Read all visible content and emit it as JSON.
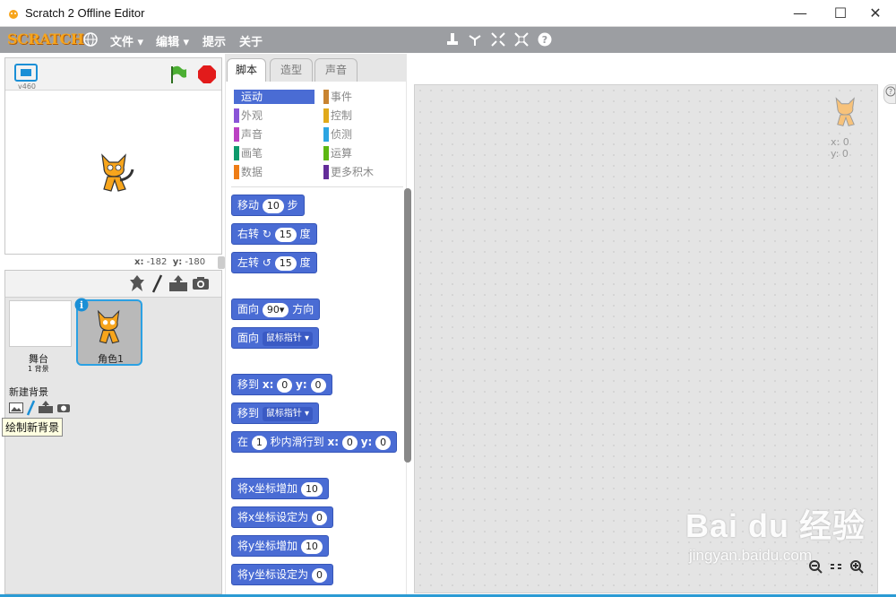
{
  "window": {
    "title": "Scratch 2 Offline Editor",
    "minimize": "—",
    "maximize": "☐",
    "close": "✕"
  },
  "menubar": {
    "logo": "SCRATCH",
    "items": [
      {
        "label": "文件 ▾"
      },
      {
        "label": "编辑 ▾"
      },
      {
        "label": "提示"
      },
      {
        "label": "关于"
      }
    ],
    "tools": [
      "duplicate-icon",
      "cut-icon",
      "grow-icon",
      "shrink-icon",
      "help-icon"
    ]
  },
  "stage": {
    "version": "v460",
    "coords": {
      "x_label": "x:",
      "x": "-182",
      "y_label": "y:",
      "y": "-180"
    }
  },
  "sprites": {
    "stage_thumb": {
      "label": "舞台",
      "sub": "1 背景"
    },
    "new_backdrop": "新建背景",
    "sprite1": {
      "label": "角色1"
    },
    "tooltip": "绘制新背景"
  },
  "tabs": [
    {
      "label": "脚本"
    },
    {
      "label": "造型"
    },
    {
      "label": "声音"
    }
  ],
  "categories": [
    {
      "label": "运动",
      "color": "#4a6cd4"
    },
    {
      "label": "事件",
      "color": "#c88330"
    },
    {
      "label": "外观",
      "color": "#8a55d7"
    },
    {
      "label": "控制",
      "color": "#e1a91a"
    },
    {
      "label": "声音",
      "color": "#bb42c3"
    },
    {
      "label": "侦测",
      "color": "#2ca5e2"
    },
    {
      "label": "画笔",
      "color": "#0e9a6c"
    },
    {
      "label": "运算",
      "color": "#5cb712"
    },
    {
      "label": "数据",
      "color": "#ee7d16"
    },
    {
      "label": "更多积木",
      "color": "#632d99"
    }
  ],
  "blocks": {
    "move": {
      "a": "移动",
      "n": "10",
      "b": "步"
    },
    "turn_right": {
      "a": "右转",
      "icon": "↻",
      "n": "15",
      "b": "度"
    },
    "turn_left": {
      "a": "左转",
      "icon": "↺",
      "n": "15",
      "b": "度"
    },
    "point_dir": {
      "a": "面向",
      "n": "90▾",
      "b": "方向"
    },
    "point_towards": {
      "a": "面向",
      "dd": "鼠标指针 ▾"
    },
    "goto_xy": {
      "a": "移到",
      "x": "x:",
      "xv": "0",
      "y": "y:",
      "yv": "0"
    },
    "goto": {
      "a": "移到",
      "dd": "鼠标指针 ▾"
    },
    "glide": {
      "a": "在",
      "n": "1",
      "b": "秒内滑行到",
      "x": "x:",
      "xv": "0",
      "y": "y:",
      "yv": "0"
    },
    "change_x": {
      "a": "将x坐标增加",
      "n": "10"
    },
    "set_x": {
      "a": "将x坐标设定为",
      "n": "0"
    },
    "change_y": {
      "a": "将y坐标增加",
      "n": "10"
    },
    "set_y": {
      "a": "将y坐标设定为",
      "n": "0"
    }
  },
  "script_area": {
    "x": "x: 0",
    "y": "y: 0"
  },
  "watermark": {
    "big": "Bai du 经验",
    "sub": "jingyan.baidu.com"
  }
}
